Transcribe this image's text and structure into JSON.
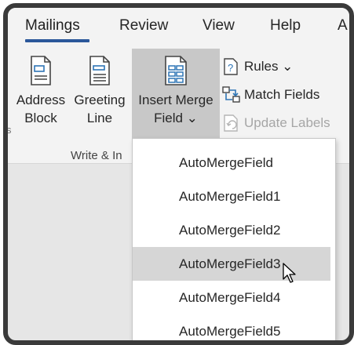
{
  "tabs": [
    {
      "label": "Mailings",
      "active": true
    },
    {
      "label": "Review"
    },
    {
      "label": "View"
    },
    {
      "label": "Help"
    },
    {
      "label": "A"
    }
  ],
  "ribbon": {
    "address_block": {
      "line1": "Address",
      "line2": "Block"
    },
    "greeting_line": {
      "line1": "Greeting",
      "line2": "Line"
    },
    "insert_merge_field": {
      "line1": "Insert Merge",
      "line2": "Field ⌄"
    },
    "rules": "Rules ⌄",
    "match_fields": "Match Fields",
    "update_labels": "Update Labels",
    "group_label": "Write & In",
    "side_stub": "s"
  },
  "dropdown": {
    "items": [
      "AutoMergeField",
      "AutoMergeField1",
      "AutoMergeField2",
      "AutoMergeField3",
      "AutoMergeField4",
      "AutoMergeField5"
    ],
    "hovered_index": 3
  },
  "colors": {
    "accent": "#2b579a",
    "frame": "#3a3a3a",
    "hover": "#d6d6d6"
  }
}
